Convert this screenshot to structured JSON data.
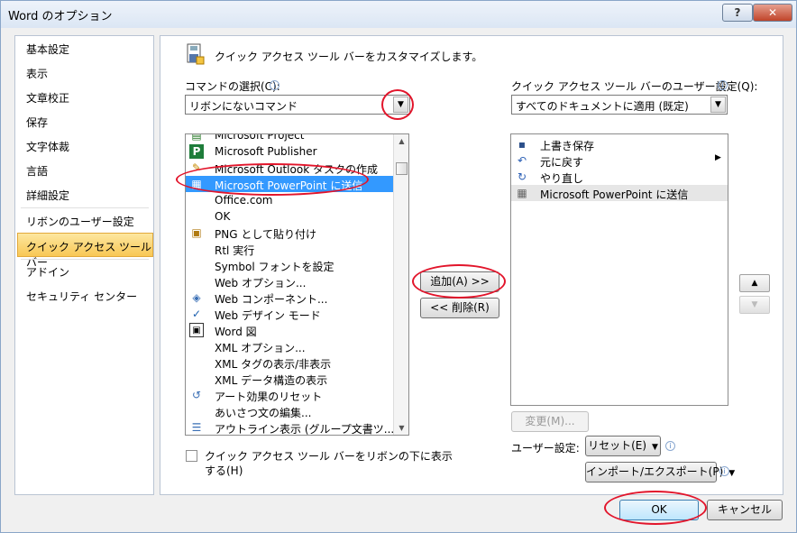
{
  "window": {
    "title": "Word のオプション",
    "help": "?",
    "close": "✕"
  },
  "sidebar": {
    "items": [
      "基本設定",
      "表示",
      "文章校正",
      "保存",
      "文字体裁",
      "言語",
      "詳細設定",
      "リボンのユーザー設定",
      "クイック アクセス ツール バー",
      "アドイン",
      "セキュリティ センター"
    ],
    "selected_index": 8
  },
  "main": {
    "heading": "クイック アクセス ツール バーをカスタマイズします。",
    "commands_label": "コマンドの選択(C):",
    "commands_combo_value": "リボンにないコマンド",
    "qat_label": "クイック アクセス ツール バーのユーザー設定(Q):",
    "qat_combo_value": "すべてのドキュメントに適用 (既定)",
    "commands_list": [
      {
        "icon": "project-icon",
        "label": "Microsoft Project"
      },
      {
        "icon": "publisher-icon",
        "label": "Microsoft Publisher"
      },
      {
        "icon": "outlook-task-icon",
        "label": "Microsoft Outlook タスクの作成"
      },
      {
        "icon": "powerpoint-send-icon",
        "label": "Microsoft PowerPoint に送信",
        "selected": true
      },
      {
        "icon": "",
        "label": "Office.com"
      },
      {
        "icon": "",
        "label": "OK"
      },
      {
        "icon": "paste-icon",
        "label": "PNG として貼り付け"
      },
      {
        "icon": "",
        "label": "Rtl 実行"
      },
      {
        "icon": "",
        "label": "Symbol フォントを設定"
      },
      {
        "icon": "",
        "label": "Web オプション..."
      },
      {
        "icon": "web-component-icon",
        "label": "Web コンポーネント..."
      },
      {
        "icon": "checkmark-icon",
        "label": "Web デザイン モード"
      },
      {
        "icon": "word-picture-icon",
        "label": "Word 図"
      },
      {
        "icon": "",
        "label": "XML オプション..."
      },
      {
        "icon": "",
        "label": "XML タグの表示/非表示"
      },
      {
        "icon": "",
        "label": "XML データ構造の表示"
      },
      {
        "icon": "animation-reset-icon",
        "label": "アート効果のリセット"
      },
      {
        "icon": "",
        "label": "あいさつ文の編集..."
      },
      {
        "icon": "outline-icon",
        "label": "アウトライン表示 (グループ文書ツ..."
      }
    ],
    "add_button": "追加(A) >>",
    "remove_button": "<< 削除(R)",
    "qat_list": [
      {
        "icon": "save-icon",
        "label": "上書き保存"
      },
      {
        "icon": "undo-icon",
        "label": "元に戻す"
      },
      {
        "icon": "redo-icon",
        "label": "やり直し"
      },
      {
        "icon": "powerpoint-send-icon",
        "label": "Microsoft PowerPoint に送信",
        "selected": true
      }
    ],
    "modify_button": "変更(M)...",
    "checkbox_label_line1": "クイック アクセス ツール バーをリボンの下に表示",
    "checkbox_label_line2": "する(H)",
    "user_settings_label": "ユーザー設定:",
    "reset_button": "リセット(E)",
    "import_export_button": "インポート/エクスポート(P)"
  },
  "footer": {
    "ok": "OK",
    "cancel": "キャンセル"
  },
  "colors": {
    "selection": "#3399ff",
    "highlight_ellipse": "#e2152b",
    "nav_selected": "#f8c754"
  }
}
